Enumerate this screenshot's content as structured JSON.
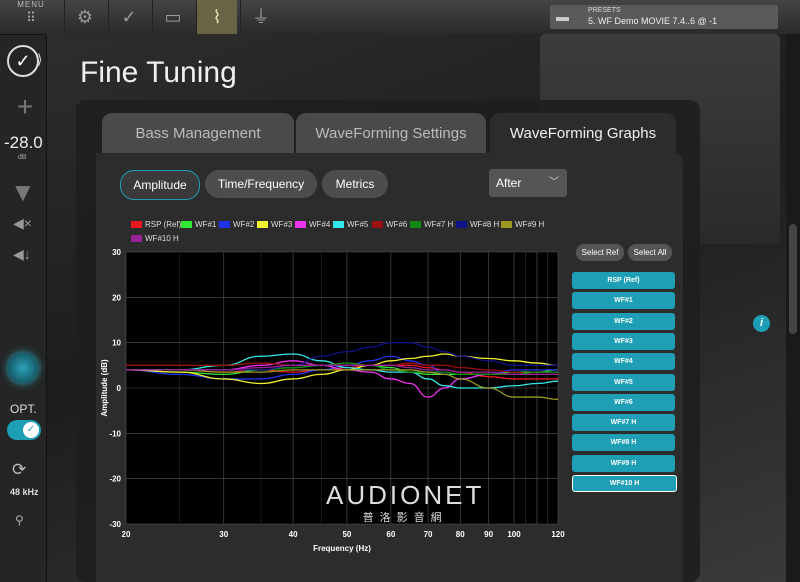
{
  "topbar": {
    "menu_label": "MENU",
    "icons": [
      "grid-icon",
      "gear-icon",
      "check-icon",
      "display-icon",
      "graph-icon",
      "adapter-icon"
    ],
    "presets_label": "PRESETS",
    "preset_name": "5. WF Demo MOVIE 7.4..6 @ -1"
  },
  "sidebar": {
    "volume_value": "-28.0",
    "volume_unit": "dB",
    "opt_label": "OPT.",
    "sample_rate": "48 kHz"
  },
  "page": {
    "title": "Fine Tuning"
  },
  "tabs": [
    {
      "label": "Bass Management",
      "active": false
    },
    {
      "label": "WaveForming Settings",
      "active": false
    },
    {
      "label": "WaveForming Graphs",
      "active": true
    }
  ],
  "graph_modes": [
    {
      "label": "Amplitude",
      "active": true
    },
    {
      "label": "Time/Frequency",
      "active": false
    },
    {
      "label": "Metrics",
      "active": false
    }
  ],
  "view_select": {
    "value": "After"
  },
  "buttons": {
    "select_ref": "Select Ref",
    "select_all": "Select All"
  },
  "channel_buttons": [
    "RSP (Ref)",
    "WF#1",
    "WF#2",
    "WF#3",
    "WF#4",
    "WF#5",
    "WF#6",
    "WF#7 H",
    "WF#8 H",
    "WF#9 H",
    "WF#10 H"
  ],
  "selected_channel": "WF#10 H",
  "watermark": {
    "line1": "AUDIONET",
    "line2": "普洛影音網"
  },
  "colors": {
    "accent": "#1e9fb5",
    "RSP": "#e8191c",
    "WF#1": "#33e633",
    "WF#2": "#2233ee",
    "WF#3": "#f2f233",
    "WF#4": "#ee33ee",
    "WF#5": "#33e8e8",
    "WF#6": "#991111",
    "WF#7 H": "#118811",
    "WF#8 H": "#111188",
    "WF#9 H": "#999922",
    "WF#10 H": "#992299"
  },
  "chart_data": {
    "type": "line",
    "xlabel": "Frequency (Hz)",
    "ylabel": "Amplitude (dB)",
    "x_scale": "log",
    "xlim": [
      20,
      120
    ],
    "ylim": [
      -30,
      30
    ],
    "x_ticks": [
      20,
      30,
      40,
      50,
      60,
      70,
      80,
      90,
      100,
      120
    ],
    "y_ticks": [
      30,
      20,
      10,
      0,
      -10,
      -20,
      -30
    ],
    "grid": true,
    "legend_placement": "top",
    "x": [
      20,
      25,
      30,
      35,
      40,
      45,
      50,
      55,
      60,
      65,
      70,
      75,
      80,
      90,
      100,
      110,
      120
    ],
    "series": [
      {
        "name": "RSP",
        "values": [
          4,
          4,
          3.5,
          4,
          3.5,
          4,
          4.5,
          5,
          5,
          5,
          4.5,
          4,
          3.5,
          2.5,
          2,
          2,
          2
        ]
      },
      {
        "name": "WF#1",
        "values": [
          4,
          3.5,
          3,
          4,
          4.5,
          5,
          5,
          5,
          4.5,
          3.5,
          3,
          3,
          3,
          3,
          3.5,
          3.5,
          4
        ]
      },
      {
        "name": "WF#2",
        "values": [
          4,
          3,
          2,
          2,
          3,
          4,
          5,
          6,
          7,
          6,
          5,
          3,
          2,
          3,
          4,
          4,
          4
        ]
      },
      {
        "name": "WF#3",
        "values": [
          4,
          3.5,
          2,
          1,
          2,
          3,
          4,
          5,
          6,
          6.5,
          7,
          7.5,
          7,
          6.5,
          6,
          5.5,
          5
        ]
      },
      {
        "name": "WF#4",
        "values": [
          4,
          4,
          4,
          5,
          6,
          5,
          4,
          3.5,
          2,
          1,
          -2,
          0,
          2,
          3,
          3,
          3.5,
          3.5
        ]
      },
      {
        "name": "WF#5",
        "values": [
          4,
          4,
          5,
          7,
          7.5,
          6,
          4.5,
          4,
          3.5,
          3.5,
          2,
          0.5,
          0,
          0,
          0.5,
          1,
          1.5
        ]
      },
      {
        "name": "WF#6",
        "values": [
          5,
          5,
          5,
          5.5,
          5,
          5,
          5,
          5,
          5,
          5.5,
          5,
          5,
          4.5,
          4,
          3.5,
          3,
          3
        ]
      },
      {
        "name": "WF#7 H",
        "values": [
          4,
          4,
          4,
          4,
          4.5,
          5,
          5.5,
          5,
          4,
          3.5,
          3.5,
          3.5,
          3,
          3,
          3,
          3.5,
          3.5
        ]
      },
      {
        "name": "WF#8 H",
        "values": [
          4,
          4,
          4,
          4,
          5,
          7,
          8,
          9,
          10,
          10,
          9,
          8,
          7,
          6,
          5,
          5,
          5
        ]
      },
      {
        "name": "WF#9 H",
        "values": [
          4,
          4,
          3.5,
          3.5,
          4,
          4,
          4,
          4,
          4,
          4,
          3.5,
          3,
          2,
          0,
          -2,
          -2,
          -2.5
        ]
      },
      {
        "name": "WF#10 H",
        "values": [
          4,
          4,
          4,
          4.5,
          5,
          5,
          5,
          5,
          5,
          4.5,
          4,
          4,
          3.5,
          3.5,
          3,
          3,
          3
        ]
      }
    ]
  }
}
